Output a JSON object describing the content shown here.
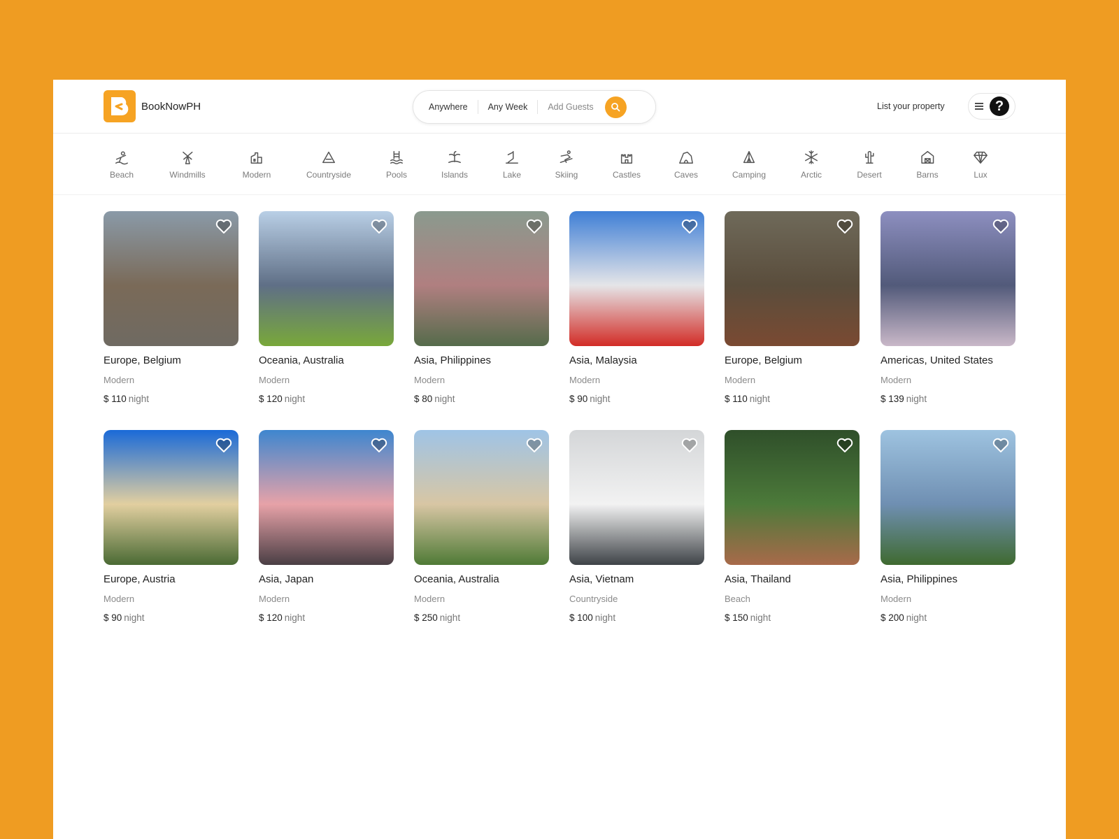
{
  "brand": {
    "name": "BookNowPH",
    "accent": "#F6A323",
    "background": "#EF9C22"
  },
  "search": {
    "where": "Anywhere",
    "when": "Any Week",
    "guests": "Add Guests",
    "button_icon": "search-icon"
  },
  "header": {
    "list_property": "List your property",
    "menu_icon": "hamburger-icon",
    "avatar_icon": "question-avatar-icon",
    "avatar_glyph": "?"
  },
  "categories": [
    {
      "label": "Beach",
      "icon": "beach-icon"
    },
    {
      "label": "Windmills",
      "icon": "windmill-icon"
    },
    {
      "label": "Modern",
      "icon": "modern-house-icon"
    },
    {
      "label": "Countryside",
      "icon": "mountain-icon"
    },
    {
      "label": "Pools",
      "icon": "pool-icon"
    },
    {
      "label": "Islands",
      "icon": "island-icon"
    },
    {
      "label": "Lake",
      "icon": "lake-icon"
    },
    {
      "label": "Skiing",
      "icon": "skiing-icon"
    },
    {
      "label": "Castles",
      "icon": "castle-icon"
    },
    {
      "label": "Caves",
      "icon": "cave-icon"
    },
    {
      "label": "Camping",
      "icon": "camping-icon"
    },
    {
      "label": "Arctic",
      "icon": "snowflake-icon"
    },
    {
      "label": "Desert",
      "icon": "cactus-icon"
    },
    {
      "label": "Barns",
      "icon": "barn-icon"
    },
    {
      "label": "Lux",
      "icon": "diamond-icon"
    }
  ],
  "listings": [
    {
      "location": "Europe, Belgium",
      "type": "Modern",
      "price": "$ 110",
      "unit": "night",
      "photo": [
        "#8a9aa8",
        "#7a6a58",
        "#6f6a62"
      ]
    },
    {
      "location": "Oceania, Australia",
      "type": "Modern",
      "price": "$ 120",
      "unit": "night",
      "photo": [
        "#b9cfe6",
        "#5f6f86",
        "#79a83a"
      ]
    },
    {
      "location": "Asia, Philippines",
      "type": "Modern",
      "price": "$ 80",
      "unit": "night",
      "photo": [
        "#8a9a8e",
        "#b07f80",
        "#556b4b"
      ]
    },
    {
      "location": "Asia, Malaysia",
      "type": "Modern",
      "price": "$ 90",
      "unit": "night",
      "photo": [
        "#3f7fd6",
        "#e5e5e8",
        "#d22c26"
      ]
    },
    {
      "location": "Europe, Belgium",
      "type": "Modern",
      "price": "$ 110",
      "unit": "night",
      "photo": [
        "#6f6a5a",
        "#5a4d3c",
        "#7a4a32"
      ]
    },
    {
      "location": "Americas, United States",
      "type": "Modern",
      "price": "$ 139",
      "unit": "night",
      "photo": [
        "#8d8fc0",
        "#525a7a",
        "#c9b8c8"
      ]
    },
    {
      "location": "Europe, Austria",
      "type": "Modern",
      "price": "$ 90",
      "unit": "night",
      "photo": [
        "#1a6ad8",
        "#e2cfa0",
        "#4a6a34"
      ]
    },
    {
      "location": "Asia, Japan",
      "type": "Modern",
      "price": "$ 120",
      "unit": "night",
      "photo": [
        "#3e86cf",
        "#e7a2a8",
        "#4a3e44"
      ]
    },
    {
      "location": "Oceania, Australia",
      "type": "Modern",
      "price": "$ 250",
      "unit": "night",
      "photo": [
        "#9fc4e6",
        "#d8c6a4",
        "#4f7a36"
      ]
    },
    {
      "location": "Asia, Vietnam",
      "type": "Countryside",
      "price": "$ 100",
      "unit": "night",
      "photo": [
        "#d4d6d8",
        "#f2f2f2",
        "#3e4347"
      ]
    },
    {
      "location": "Asia, Thailand",
      "type": "Beach",
      "price": "$ 150",
      "unit": "night",
      "photo": [
        "#2f4f2a",
        "#4c7a3a",
        "#a86a4a"
      ]
    },
    {
      "location": "Asia, Philippines",
      "type": "Modern",
      "price": "$ 200",
      "unit": "night",
      "photo": [
        "#9ec3e0",
        "#6f8fb2",
        "#3f6a30"
      ]
    }
  ]
}
